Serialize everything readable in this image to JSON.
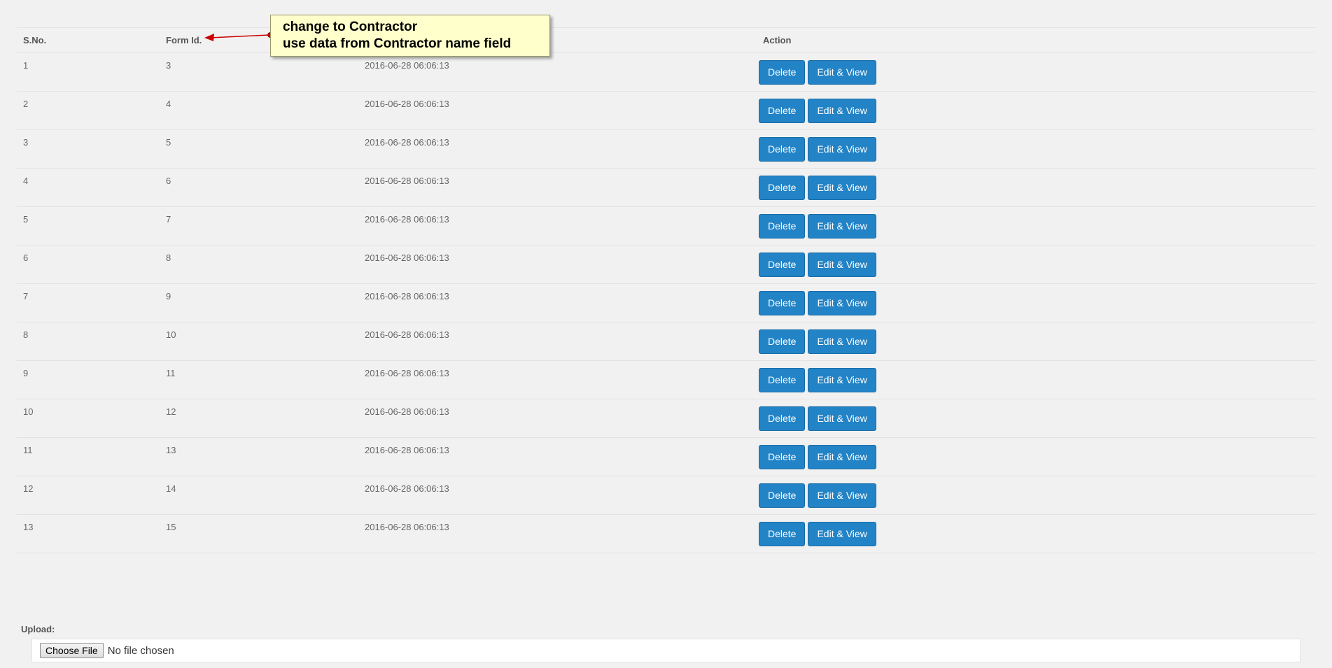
{
  "table": {
    "headers": {
      "sno": "S.No.",
      "form_id": "Form Id.",
      "date": "",
      "action": "Action"
    },
    "rows": [
      {
        "sno": "1",
        "form_id": "3",
        "date": "2016-06-28 06:06:13",
        "delete_label": "Delete",
        "edit_label": "Edit & View"
      },
      {
        "sno": "2",
        "form_id": "4",
        "date": "2016-06-28 06:06:13",
        "delete_label": "Delete",
        "edit_label": "Edit & View"
      },
      {
        "sno": "3",
        "form_id": "5",
        "date": "2016-06-28 06:06:13",
        "delete_label": "Delete",
        "edit_label": "Edit & View"
      },
      {
        "sno": "4",
        "form_id": "6",
        "date": "2016-06-28 06:06:13",
        "delete_label": "Delete",
        "edit_label": "Edit & View"
      },
      {
        "sno": "5",
        "form_id": "7",
        "date": "2016-06-28 06:06:13",
        "delete_label": "Delete",
        "edit_label": "Edit & View"
      },
      {
        "sno": "6",
        "form_id": "8",
        "date": "2016-06-28 06:06:13",
        "delete_label": "Delete",
        "edit_label": "Edit & View"
      },
      {
        "sno": "7",
        "form_id": "9",
        "date": "2016-06-28 06:06:13",
        "delete_label": "Delete",
        "edit_label": "Edit & View"
      },
      {
        "sno": "8",
        "form_id": "10",
        "date": "2016-06-28 06:06:13",
        "delete_label": "Delete",
        "edit_label": "Edit & View"
      },
      {
        "sno": "9",
        "form_id": "11",
        "date": "2016-06-28 06:06:13",
        "delete_label": "Delete",
        "edit_label": "Edit & View"
      },
      {
        "sno": "10",
        "form_id": "12",
        "date": "2016-06-28 06:06:13",
        "delete_label": "Delete",
        "edit_label": "Edit & View"
      },
      {
        "sno": "11",
        "form_id": "13",
        "date": "2016-06-28 06:06:13",
        "delete_label": "Delete",
        "edit_label": "Edit & View"
      },
      {
        "sno": "12",
        "form_id": "14",
        "date": "2016-06-28 06:06:13",
        "delete_label": "Delete",
        "edit_label": "Edit & View"
      },
      {
        "sno": "13",
        "form_id": "15",
        "date": "2016-06-28 06:06:13",
        "delete_label": "Delete",
        "edit_label": "Edit & View"
      }
    ]
  },
  "annotation": {
    "line1": "change to Contractor",
    "line2": "use data from Contractor name field",
    "arrow_color": "#cc0000",
    "box_color": "#ffffcc"
  },
  "upload": {
    "label": "Upload:",
    "button_label": "Choose File",
    "status_text": "No file chosen"
  },
  "colors": {
    "button_primary": "#2283c6",
    "background": "#f1f1f1"
  }
}
